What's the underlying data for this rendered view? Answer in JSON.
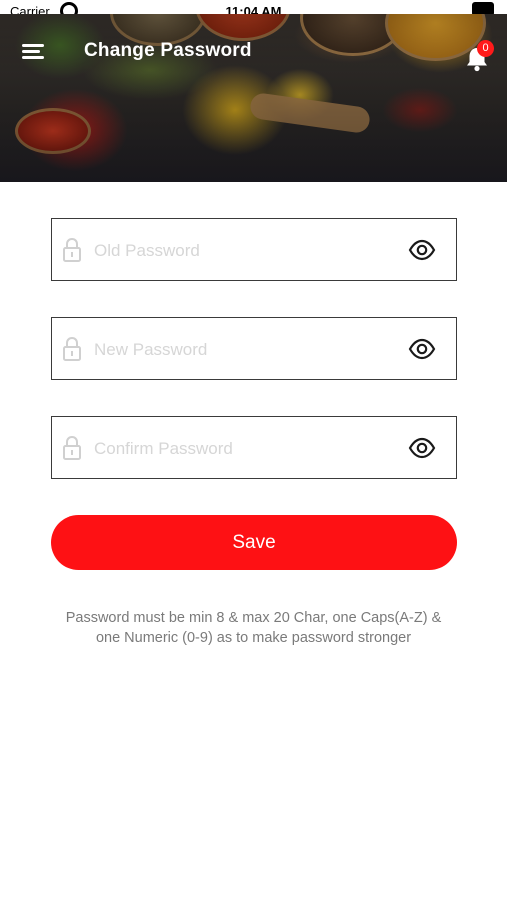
{
  "status_bar": {
    "carrier": "Carrier",
    "time": "11:04 AM"
  },
  "header": {
    "title": "Change Password",
    "menu_icon": "hamburger-menu-icon",
    "notification_icon": "bell-icon",
    "notification_count": "0"
  },
  "form": {
    "old_password": {
      "placeholder": "Old Password",
      "value": "",
      "icon": "lock-icon",
      "toggle_icon": "eye-icon"
    },
    "new_password": {
      "placeholder": "New Password",
      "value": "",
      "icon": "lock-icon",
      "toggle_icon": "eye-icon"
    },
    "confirm_password": {
      "placeholder": "Confirm Password",
      "value": "",
      "icon": "lock-icon",
      "toggle_icon": "eye-icon"
    },
    "save_label": "Save",
    "hint": "Password must be min 8 & max 20 Char, one Caps(A-Z) & one Numeric (0-9) as to make password stronger"
  },
  "colors": {
    "accent": "#fe1114",
    "badge": "#ff1a1a",
    "hint_text": "#7a7a7a",
    "placeholder": "#d6d6d6"
  }
}
